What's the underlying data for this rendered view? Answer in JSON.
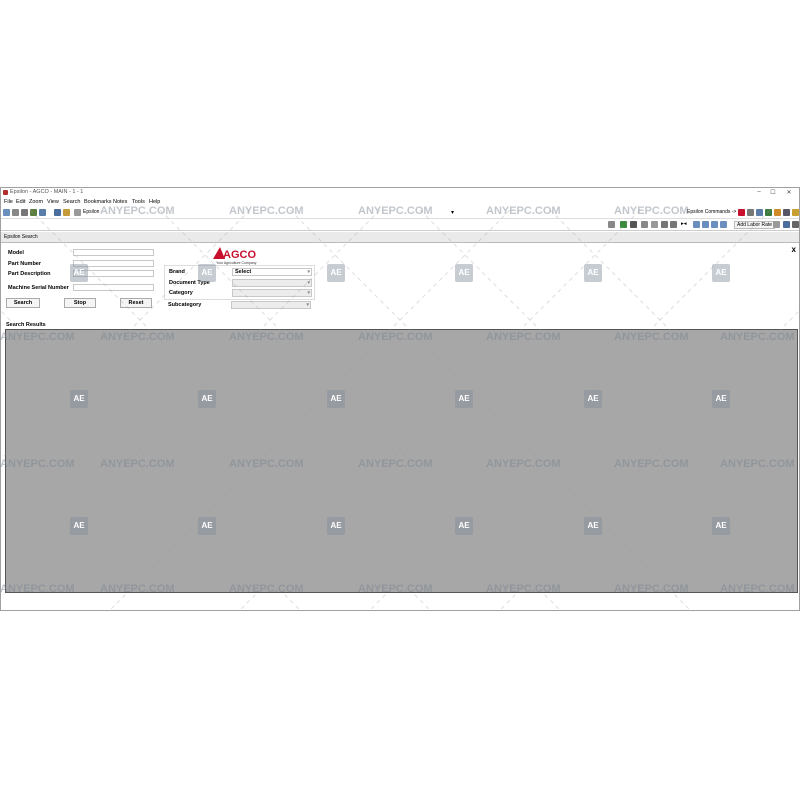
{
  "window": {
    "title": "Epsilon - AGCO - MAIN - 1 - 1",
    "controls": [
      "–",
      "☐",
      "✕"
    ]
  },
  "menu": [
    "File",
    "Edit",
    "Zoom",
    "View",
    "Search",
    "Bookmarks",
    "Notes",
    "Tools",
    "Help"
  ],
  "toolbar": {
    "epsilon_label": "Epsilon",
    "commands_label": "Epsilon Commands ->",
    "add_labor_rate": "Add Labor Rate"
  },
  "tab": {
    "label": "Epsilon Search",
    "close": "x"
  },
  "search_form": {
    "model_label": "Model",
    "part_number_label": "Part Number",
    "part_description_label": "Part Description",
    "machine_serial_label": "Machine Serial Number",
    "search_button": "Search",
    "stop_button": "Stop",
    "reset_button": "Reset"
  },
  "filters": {
    "brand_label": "Brand",
    "brand_value": "Select",
    "document_type_label": "Document Type",
    "category_label": "Category",
    "subcategory_label": "Subcategory"
  },
  "logo": {
    "name": "AGCO",
    "tagline": "Your Agriculture Company",
    "color": "#c8102e"
  },
  "results": {
    "label": "Search Results",
    "background": "#a7a7a7"
  },
  "watermark": {
    "text": "ANYEPC.COM",
    "badge": "AE"
  }
}
